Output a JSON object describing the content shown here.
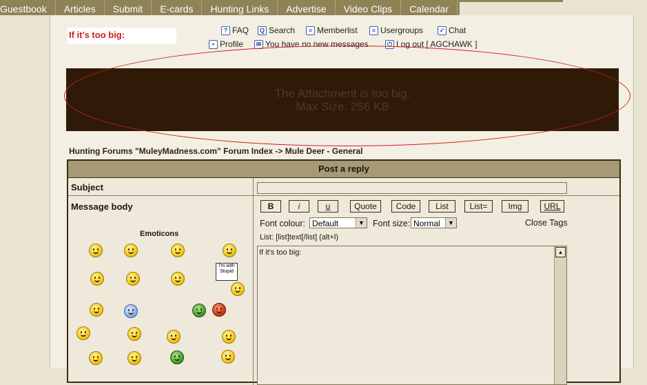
{
  "nav": [
    "Guestbook",
    "Articles",
    "Submit",
    "E-cards",
    "Hunting Links",
    "Advertise",
    "Video Clips",
    "Calendar"
  ],
  "draft_title": "If it's too big:",
  "toplinks": {
    "faq": "FAQ",
    "search": "Search",
    "memberlist": "Memberlist",
    "usergroups": "Usergroups",
    "chat": "Chat",
    "profile": "Profile",
    "messages": "You have no new messages",
    "logout": "Log out [ AGCHAWK ]"
  },
  "banner": {
    "line1": "The Attachment is too big.",
    "line2": "Max Size: 256 KB"
  },
  "breadcrumb": {
    "index": "Hunting Forums \"MuleyMadness.com\" Forum Index",
    "separator": " -> ",
    "forum": "Mule Deer - General"
  },
  "form": {
    "header": "Post a reply",
    "subject_label": "Subject",
    "subject_value": "",
    "body_label": "Message body",
    "emoticons_label": "Emoticons",
    "emoticon_sign_text": "I'm with Stupid",
    "buttons": [
      "B",
      "i",
      "u",
      "Quote",
      "Code",
      "List",
      "List=",
      "Img",
      "URL"
    ],
    "font_colour_label": "Font colour:",
    "font_colour_value": "Default",
    "font_size_label": "Font size:",
    "font_size_value": "Normal",
    "close_tags": "Close Tags",
    "help_line": "List: [list]text[/list] (alt+l)",
    "message_text": "If it's too big:"
  },
  "emoticons": [
    "confused",
    "rolleyes",
    "crying",
    "thinking",
    "dunno",
    "wave",
    "nervous",
    "stupid-sign",
    "gunfire",
    "thumbs-up",
    "archer",
    "football",
    "shooter",
    "smile",
    "sleepy",
    "questioning",
    "grin",
    "whistle",
    "clover",
    "angry"
  ]
}
